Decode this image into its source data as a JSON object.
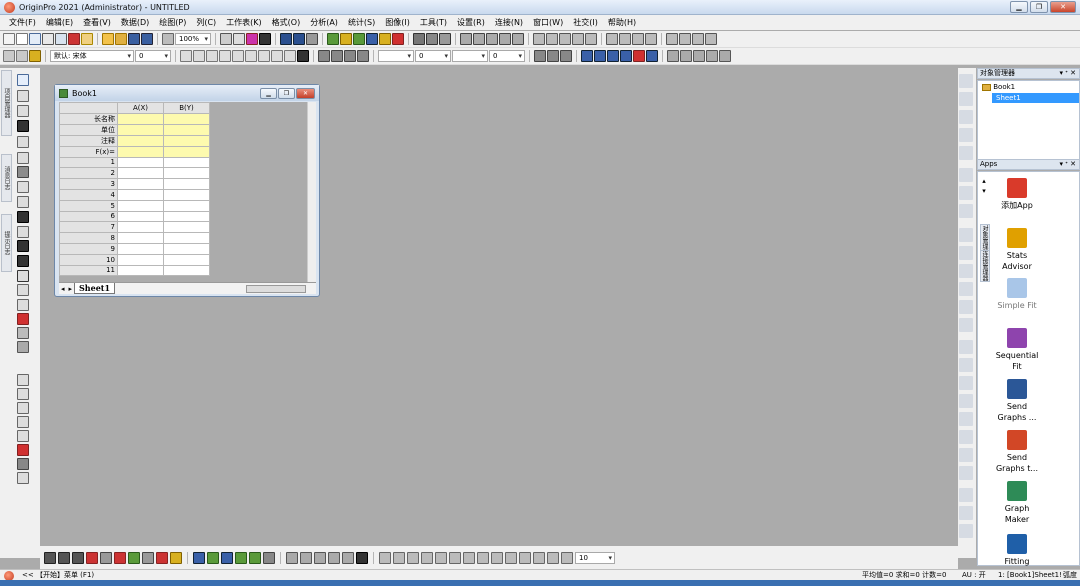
{
  "window": {
    "title": "OriginPro 2021 (Administrator) - UNTITLED",
    "min": "▁",
    "max": "❐",
    "close": "✕"
  },
  "menus": [
    "文件(F)",
    "编辑(E)",
    "查看(V)",
    "数据(D)",
    "绘图(P)",
    "列(C)",
    "工作表(K)",
    "格式(O)",
    "分析(A)",
    "统计(S)",
    "图像(I)",
    "工具(T)",
    "设置(R)",
    "连接(N)",
    "窗口(W)",
    "社交(I)",
    "帮助(H)"
  ],
  "toolbar": {
    "zoom": "100%",
    "font_name": "默认: 宋体",
    "font_size": "0",
    "line_width": "0",
    "fill_value": "0",
    "bottom_value": "10"
  },
  "left_tabs": [
    "项目管理器",
    "消息日志",
    "提示日志"
  ],
  "book": {
    "title": "Book1",
    "columns": [
      "A(X)",
      "B(Y)"
    ],
    "header_rows": [
      "长名称",
      "单位",
      "注释",
      "F(x)="
    ],
    "data_rows": [
      "1",
      "2",
      "3",
      "4",
      "5",
      "6",
      "7",
      "8",
      "9",
      "10",
      "11"
    ],
    "sheet_tab": "Sheet1"
  },
  "object_manager": {
    "title": "对象管理器",
    "book": "Book1",
    "sheet": "Sheet1"
  },
  "apps_panel": {
    "title": "Apps",
    "side_tabs": [
      "对象管理器",
      "连接管理器"
    ],
    "items": [
      {
        "label": "添加App",
        "icon": "add-app-icon",
        "color": "#d93a2a"
      },
      {
        "label": "Stats Advisor",
        "icon": "wand-icon",
        "color": "#e0a000"
      },
      {
        "label": "Simple Fit",
        "icon": "simple-fit-icon",
        "color": "#a9c6e8"
      },
      {
        "label": "Sequential Fit",
        "icon": "sequential-fit-icon",
        "color": "#8e44ad"
      },
      {
        "label": "Send Graphs ...",
        "icon": "send-word-icon",
        "color": "#2b5797"
      },
      {
        "label": "Send Graphs t...",
        "icon": "send-ppt-icon",
        "color": "#d24726"
      },
      {
        "label": "Graph Maker",
        "icon": "graph-maker-icon",
        "color": "#2e8b57"
      },
      {
        "label": "Fitting",
        "icon": "fitting-icon",
        "color": "#1f5fa8"
      }
    ]
  },
  "status": {
    "left": "<< 【开始】菜单 (F1)",
    "stats": "平均值=0 求和=0 计数=0",
    "au": "AU : 开",
    "active": "1: [Book1]Sheet1!",
    "angle": "弧度"
  }
}
